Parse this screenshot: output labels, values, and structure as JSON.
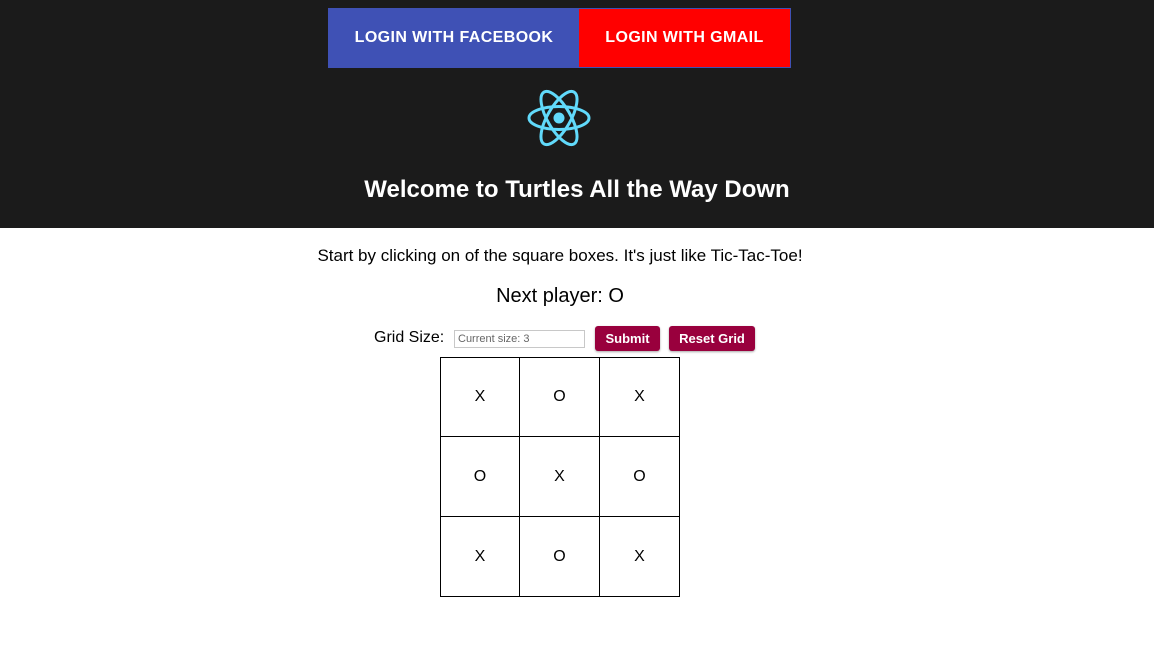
{
  "header": {
    "login_facebook": "LOGIN WITH FACEBOOK",
    "login_gmail": "LOGIN WITH GMAIL",
    "logo_icon": "react-atom-icon",
    "welcome_title": "Welcome to Turtles All the Way Down",
    "colors": {
      "background": "#1b1b1b",
      "facebook": "#3f51b5",
      "gmail": "#ff0000",
      "logo": "#61dafb"
    }
  },
  "game": {
    "instructions": "Start by clicking on of the square boxes. It's just like Tic-Tac-Toe!",
    "next_player": "Next player: O",
    "grid_size_label": "Grid Size:",
    "grid_size_placeholder": "Current size: 3",
    "submit_label": "Submit",
    "reset_label": "Reset Grid",
    "button_color": "#99003d",
    "squares": [
      "X",
      "O",
      "X",
      "O",
      "X",
      "O",
      "X",
      "O",
      "X"
    ]
  }
}
